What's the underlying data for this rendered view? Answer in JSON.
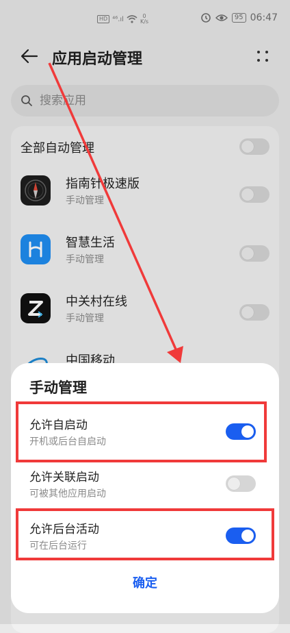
{
  "status": {
    "hd": "HD",
    "signal": "⁴⁶.ıl",
    "speed_num": "0",
    "speed_unit": "K/s",
    "battery": "95",
    "time": "06:47"
  },
  "header": {
    "title": "应用启动管理"
  },
  "search": {
    "placeholder": "搜索应用"
  },
  "list": {
    "all_label": "全部自动管理",
    "apps": [
      {
        "name": "指南针极速版",
        "sub": "手动管理",
        "icon": "compass-icon"
      },
      {
        "name": "智慧生活",
        "sub": "手动管理",
        "icon": "smart-life-icon"
      },
      {
        "name": "中关村在线",
        "sub": "手动管理",
        "icon": "zol-icon"
      },
      {
        "name": "中国移动",
        "sub": "",
        "icon": "china-mobile-icon"
      }
    ]
  },
  "sheet": {
    "title": "手动管理",
    "options": [
      {
        "label": "允许自启动",
        "sub": "开机或后台自启动",
        "enabled": true
      },
      {
        "label": "允许关联启动",
        "sub": "可被其他应用启动",
        "enabled": false
      },
      {
        "label": "允许后台活动",
        "sub": "可在后台运行",
        "enabled": true
      }
    ],
    "confirm": "确定"
  },
  "colors": {
    "accent": "#1a5ef0",
    "annotation": "#f03a3a"
  }
}
